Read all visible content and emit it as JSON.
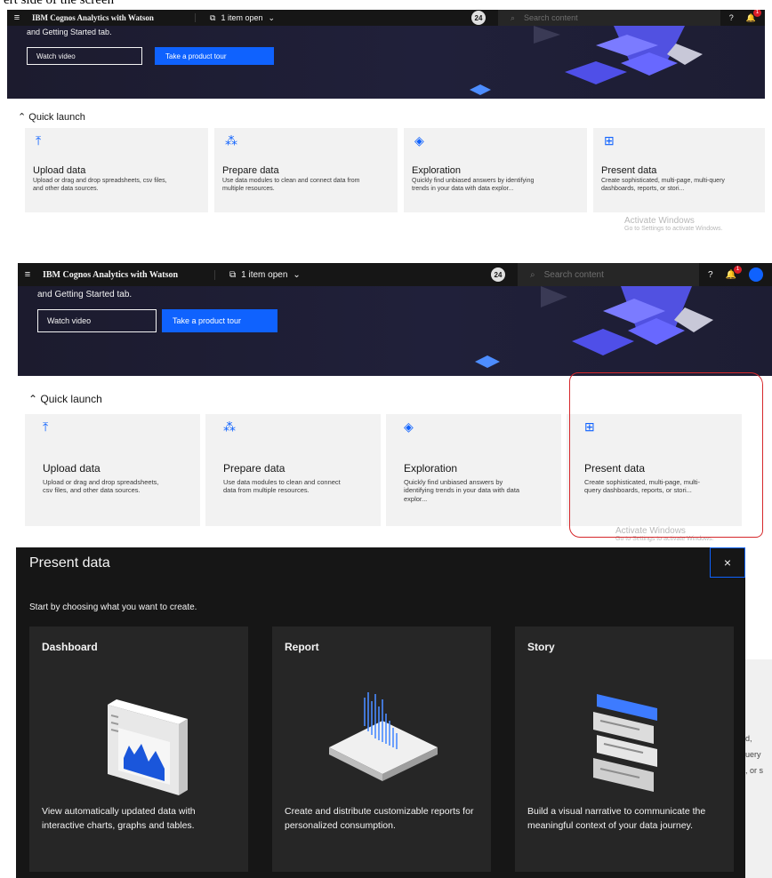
{
  "caption": "ert side of the screen",
  "topbar": {
    "app_title": "IBM Cognos Analytics with Watson",
    "open_items": "1 item open",
    "badge": "24",
    "search_placeholder": "Search content",
    "notification_count": "1"
  },
  "hero": {
    "text": "and Getting Started tab.",
    "watch_video": "Watch video",
    "product_tour": "Take a product tour"
  },
  "quick_launch": {
    "label": "Quick launch",
    "tiles": [
      {
        "title": "Upload data",
        "icon": "upload-icon",
        "desc": "Upload or drag and drop spreadsheets, csv files, and other data sources."
      },
      {
        "title": "Prepare data",
        "icon": "data-module-icon",
        "desc": "Use data modules to clean and connect data from multiple resources."
      },
      {
        "title": "Exploration",
        "icon": "exploration-icon",
        "desc": "Quickly find unbiased answers by identifying trends in your data with data explor..."
      },
      {
        "title": "Present data",
        "icon": "presentation-icon",
        "desc": "Create sophisticated, multi-page, multi-query dashboards, reports, or stori..."
      }
    ]
  },
  "activate": {
    "title": "Activate Windows",
    "sub": "Go to Settings to activate Windows."
  },
  "modal": {
    "title": "Present data",
    "close": "×",
    "subtitle": "Start by choosing what you want to create.",
    "cards": [
      {
        "title": "Dashboard",
        "desc": "View automatically updated data with interactive charts, graphs and tables."
      },
      {
        "title": "Report",
        "desc": "Create and distribute customizable reports for personalized consumption."
      },
      {
        "title": "Story",
        "desc": "Build a visual narrative to communicate the meaningful context of your data journey."
      }
    ]
  },
  "right_fragments": [
    "d,",
    "uery",
    ", or s"
  ],
  "colors": {
    "accent": "#0f62fe",
    "highlight": "#d6282b",
    "topbar": "#161616",
    "modal_bg": "#161616",
    "card_bg": "#262626"
  }
}
